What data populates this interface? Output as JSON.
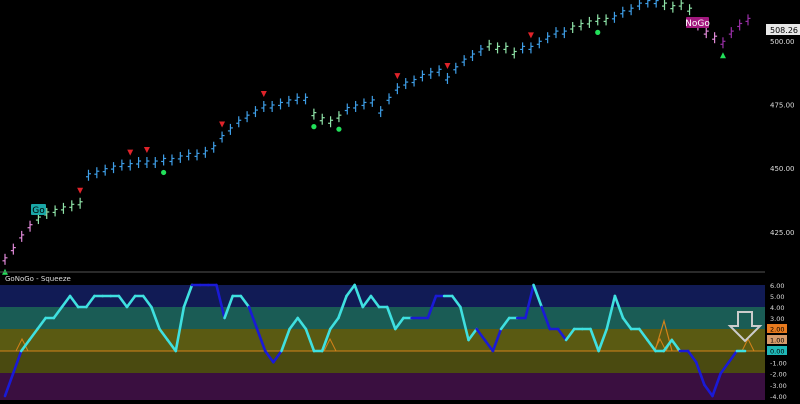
{
  "colors": {
    "background": "#000000",
    "bar_strong_up": "#3f9fe8",
    "bar_weak_up": "#8fe3a8",
    "bar_weak_down": "#e08ad8",
    "bar_strong_down": "#9a2fa8",
    "bar_neutral": "#f2f2f2",
    "go_marker": "#22e05a",
    "nogo_marker": "#e0232a",
    "go_label_bg": "#1aa7a7",
    "nogo_label_bg": "#a2187e",
    "price_tag_bg": "#e8e8e8",
    "osc_line_light": "#3fe0e0",
    "osc_line_dark": "#1a1ad6",
    "zero_line": "#d4821a",
    "arrow": "#cccccc",
    "band_top_dark": "#0a0a45",
    "band_blue": "#143a78",
    "band_teal": "#1a5c55",
    "band_olive": "#5a5a12",
    "band_olive2": "#4a4a10",
    "band_purple": "#3a0f40",
    "badge_2": "#e87a1e",
    "badge_1": "#d69a6a",
    "badge_0": "#1fb8b8"
  },
  "labels": {
    "go": "Go",
    "nogo": "NoGo",
    "panel_title": "GoNoGo - Squeeze",
    "last_price": "508.26"
  },
  "price_axis": {
    "ticks": [
      "500.00",
      "475.00",
      "450.00",
      "425.00"
    ]
  },
  "osc_axis": {
    "ticks": [
      "6.00",
      "5.00",
      "4.00",
      "3.00",
      "-1.00",
      "-2.00",
      "-3.00",
      "-4.00"
    ],
    "badges": [
      "2.00",
      "1.00",
      "0.00"
    ]
  },
  "chart_data": [
    {
      "type": "line",
      "title": "",
      "ylim": [
        418,
        512
      ],
      "colors_note": "bars colored by GoNoGo trend",
      "markers": [
        "go-marker",
        "nogo-marker"
      ],
      "series": [
        {
          "values": [
            414,
            418,
            423,
            427,
            430,
            432,
            433,
            434,
            435,
            436,
            447,
            448,
            449,
            450,
            451,
            451,
            452,
            452,
            452,
            453,
            453,
            454,
            455,
            455,
            456,
            458,
            462,
            465,
            468,
            470,
            472,
            474,
            474,
            475,
            476,
            477,
            477,
            471,
            469,
            468,
            470,
            473,
            474,
            475,
            476,
            472,
            477,
            481,
            483,
            484,
            486,
            487,
            488,
            485,
            489,
            492,
            494,
            496,
            498,
            497,
            497,
            495,
            497,
            497,
            499,
            501,
            503,
            503,
            505,
            506,
            507,
            508,
            508,
            509,
            511,
            512,
            514,
            515,
            515,
            514,
            513,
            514,
            512,
            506,
            503,
            501,
            499,
            503,
            506,
            508
          ]
        }
      ]
    },
    {
      "type": "line",
      "title": "GoNoGo - Squeeze",
      "ylim": [
        -4,
        6
      ],
      "series": [
        {
          "values": [
            -4,
            -2,
            0,
            1,
            2,
            3,
            3,
            4,
            5,
            4,
            4,
            5,
            5,
            5,
            5,
            4,
            5,
            5,
            4,
            2,
            1,
            0,
            4,
            6,
            6,
            6,
            6,
            3,
            5,
            5,
            4,
            2,
            0,
            -1,
            0,
            2,
            3,
            2,
            0,
            0,
            2,
            3,
            5,
            6,
            4,
            5,
            4,
            4,
            2,
            3,
            3,
            3,
            3,
            5,
            5,
            5,
            4,
            1,
            2,
            1,
            0,
            2,
            3,
            3,
            3,
            6,
            4,
            2,
            2,
            1,
            2,
            2,
            2,
            0,
            2,
            5,
            3,
            2,
            2,
            1,
            0,
            0,
            1,
            0,
            0,
            -1,
            -3,
            -4,
            -2,
            -1,
            0,
            0
          ]
        }
      ]
    }
  ]
}
